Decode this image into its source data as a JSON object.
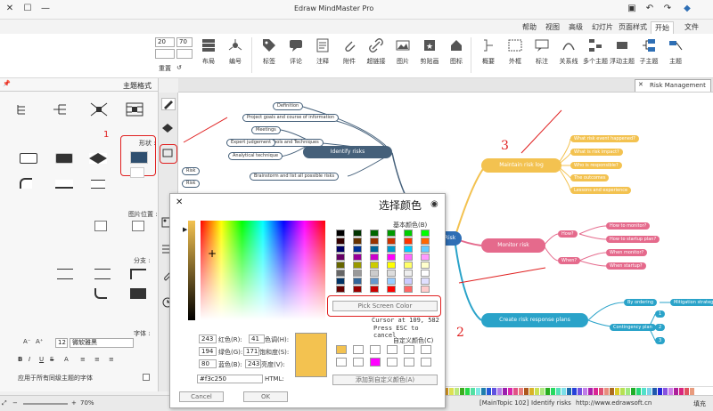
{
  "window": {
    "title": "Edraw MindMaster Pro"
  },
  "menu": [
    "文件",
    "开始",
    "页面样式",
    "幻灯片",
    "高级",
    "视图",
    "帮助"
  ],
  "menu_active": "开始",
  "ribbon": {
    "buttons": [
      "主题",
      "子主题",
      "浮动主题",
      "多个主题",
      "关系线",
      "标注",
      "外框",
      "概要",
      "图标",
      "剪贴画",
      "图片",
      "超链接",
      "附件",
      "注释",
      "评论",
      "标签",
      "编号",
      "布局"
    ],
    "font_size": "20",
    "font_size2": "70",
    "reset_label": "重置"
  },
  "left_panel": {
    "title": "主题格式",
    "shape_label": "形状 :",
    "image_position_label": "图片位置 :",
    "branch_label": "分支 :",
    "font_label": "字体 :",
    "font_name": "微软雅黑",
    "font_size": "12",
    "apply_all_label": "应用于所有同级主题的字体",
    "marker_1": "1"
  },
  "tab": {
    "label": "Risk Management"
  },
  "mindmap": {
    "center": "Risk",
    "identify": "Identify risks",
    "identify_children": [
      "Definition",
      "Project goals and course of information",
      "Meetings",
      "Tools and Techniques",
      "Expert judgement",
      "Analytical technique",
      "Brainstorm and list all possible risks"
    ],
    "risk_labels": [
      "Risk",
      "Risk"
    ],
    "maintain": "Maintain risk log",
    "maintain_children": [
      "What risk event happened?",
      "What is risk impact?",
      "Who is responsible?",
      "The outcomes",
      "Lessons and experience"
    ],
    "monitor": "Monitor risk",
    "monitor_children": [
      "How?",
      "How to monitor?",
      "How to startup plan?",
      "When?",
      "When monitor?",
      "When startup?"
    ],
    "create": "Create risk response plans",
    "create_children": [
      "By ordering",
      "Mitigation strategies",
      "Contingency plan",
      "1",
      "2",
      "3"
    ],
    "marker_2": "2",
    "marker_3": "3"
  },
  "dialog": {
    "title": "选择颜色",
    "basic_colors_label": "基本颜色(B)",
    "pick_screen_color": "Pick Screen Color",
    "cursor_info": "Cursor at 109, 582",
    "escape_info": "Press ESC to cancel",
    "custom_colors_label": "自定义颜色(C)",
    "add_custom": "添加到自定义颜色(A)",
    "hue_label": "色调(H):",
    "sat_label": "饱和度(S):",
    "val_label": "亮度(V):",
    "red_label": "红色(R):",
    "green_label": "绿色(G):",
    "blue_label": "蓝色(B):",
    "hue": "41",
    "sat": "171",
    "val": "243",
    "red": "243",
    "green": "194",
    "blue": "80",
    "html_label": "HTML:",
    "html": "#f3c250",
    "ok": "OK",
    "cancel": "Cancel"
  },
  "status": {
    "url": "http://www.edrawsoft.cn",
    "main_topic": "[MainTopic 102]",
    "selected": "Identify risks",
    "zoom": "70%",
    "fill_label": "填充"
  },
  "colors": {
    "accent_blue": "#2f6fb5",
    "node_orange": "#f3c250",
    "node_pink": "#e56a8c",
    "node_teal": "#2aa3c9",
    "node_dark": "#45607a",
    "marker_red": "#e02020"
  }
}
